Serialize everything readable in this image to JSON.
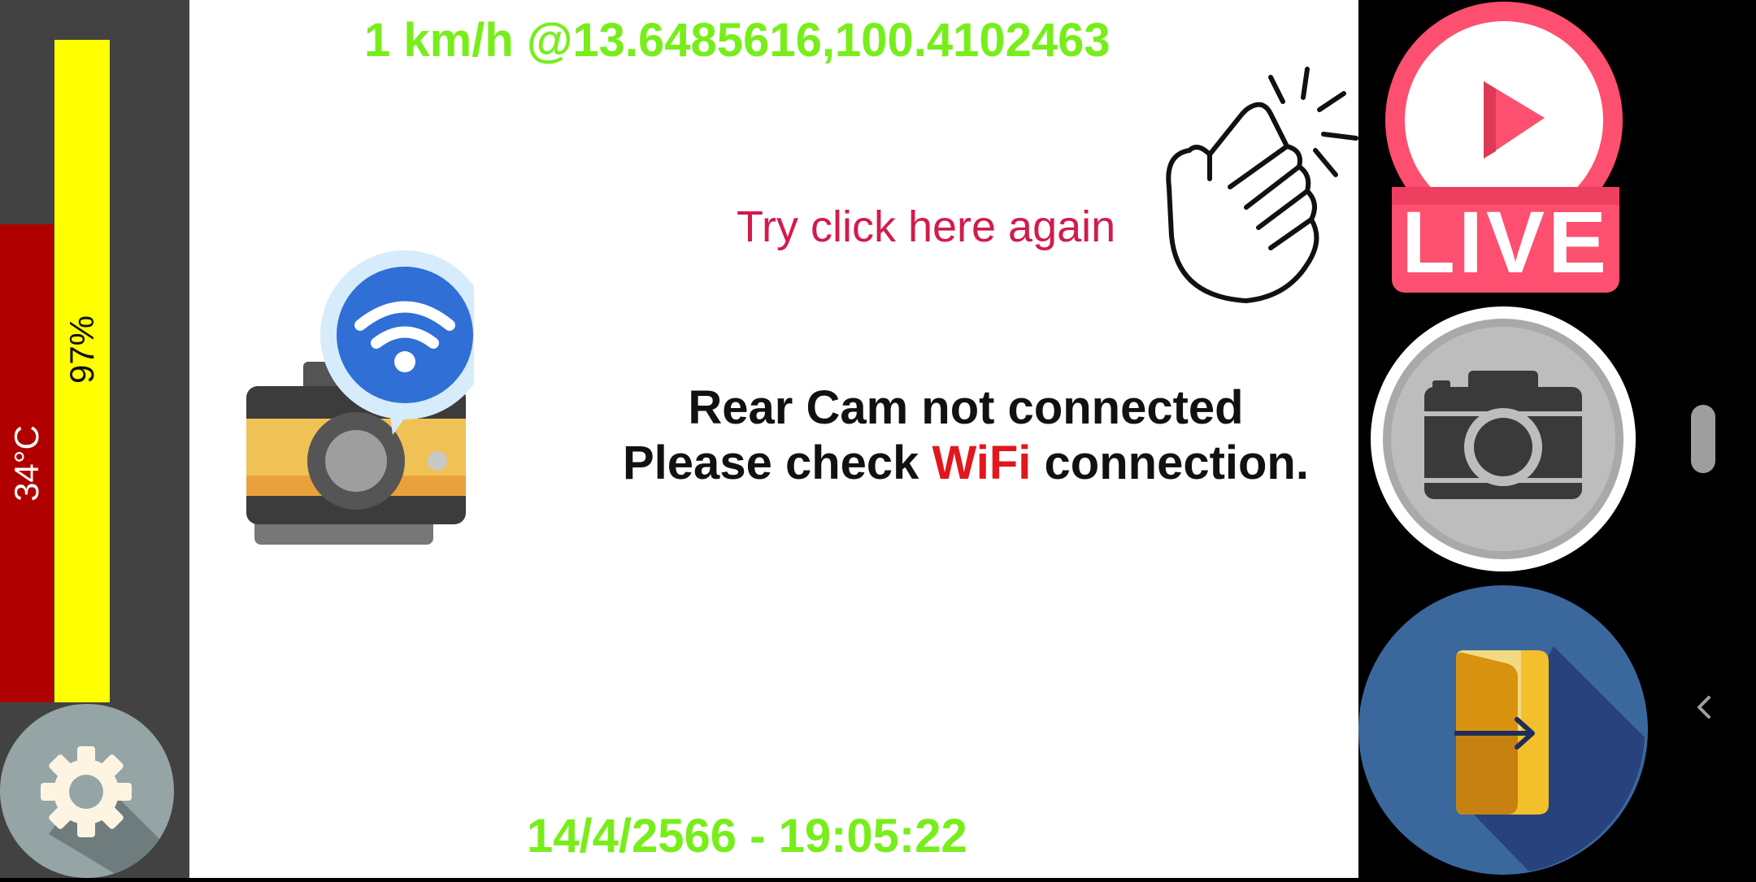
{
  "status_bar": {
    "temperature": "34°C",
    "temperature_fraction": 0.7,
    "battery": "97%",
    "battery_fraction": 0.97,
    "temperature_color": "#b10000",
    "battery_color": "#ffff00"
  },
  "overlay": {
    "gps_readout": "1 km/h @13.6485616,100.4102463",
    "timestamp": "14/4/2566 - 19:05:22",
    "text_color": "#77ee1a"
  },
  "hint": {
    "text": "Try click here again",
    "color": "#d21b4d"
  },
  "message": {
    "line1": "Rear Cam not connected",
    "line2_prefix": "Please check ",
    "line2_highlight": "WiFi",
    "line2_suffix": " connection.",
    "highlight_color": "#e0181d"
  },
  "buttons": {
    "live": {
      "label": "LIVE",
      "icon": "live-play-icon",
      "color": "#fd4f6f"
    },
    "capture": {
      "icon": "camera-icon"
    },
    "exit": {
      "icon": "exit-door-icon"
    },
    "settings": {
      "icon": "gear-icon"
    }
  },
  "system_nav": {
    "home": "home-pill",
    "back": "back-chevron-icon"
  }
}
